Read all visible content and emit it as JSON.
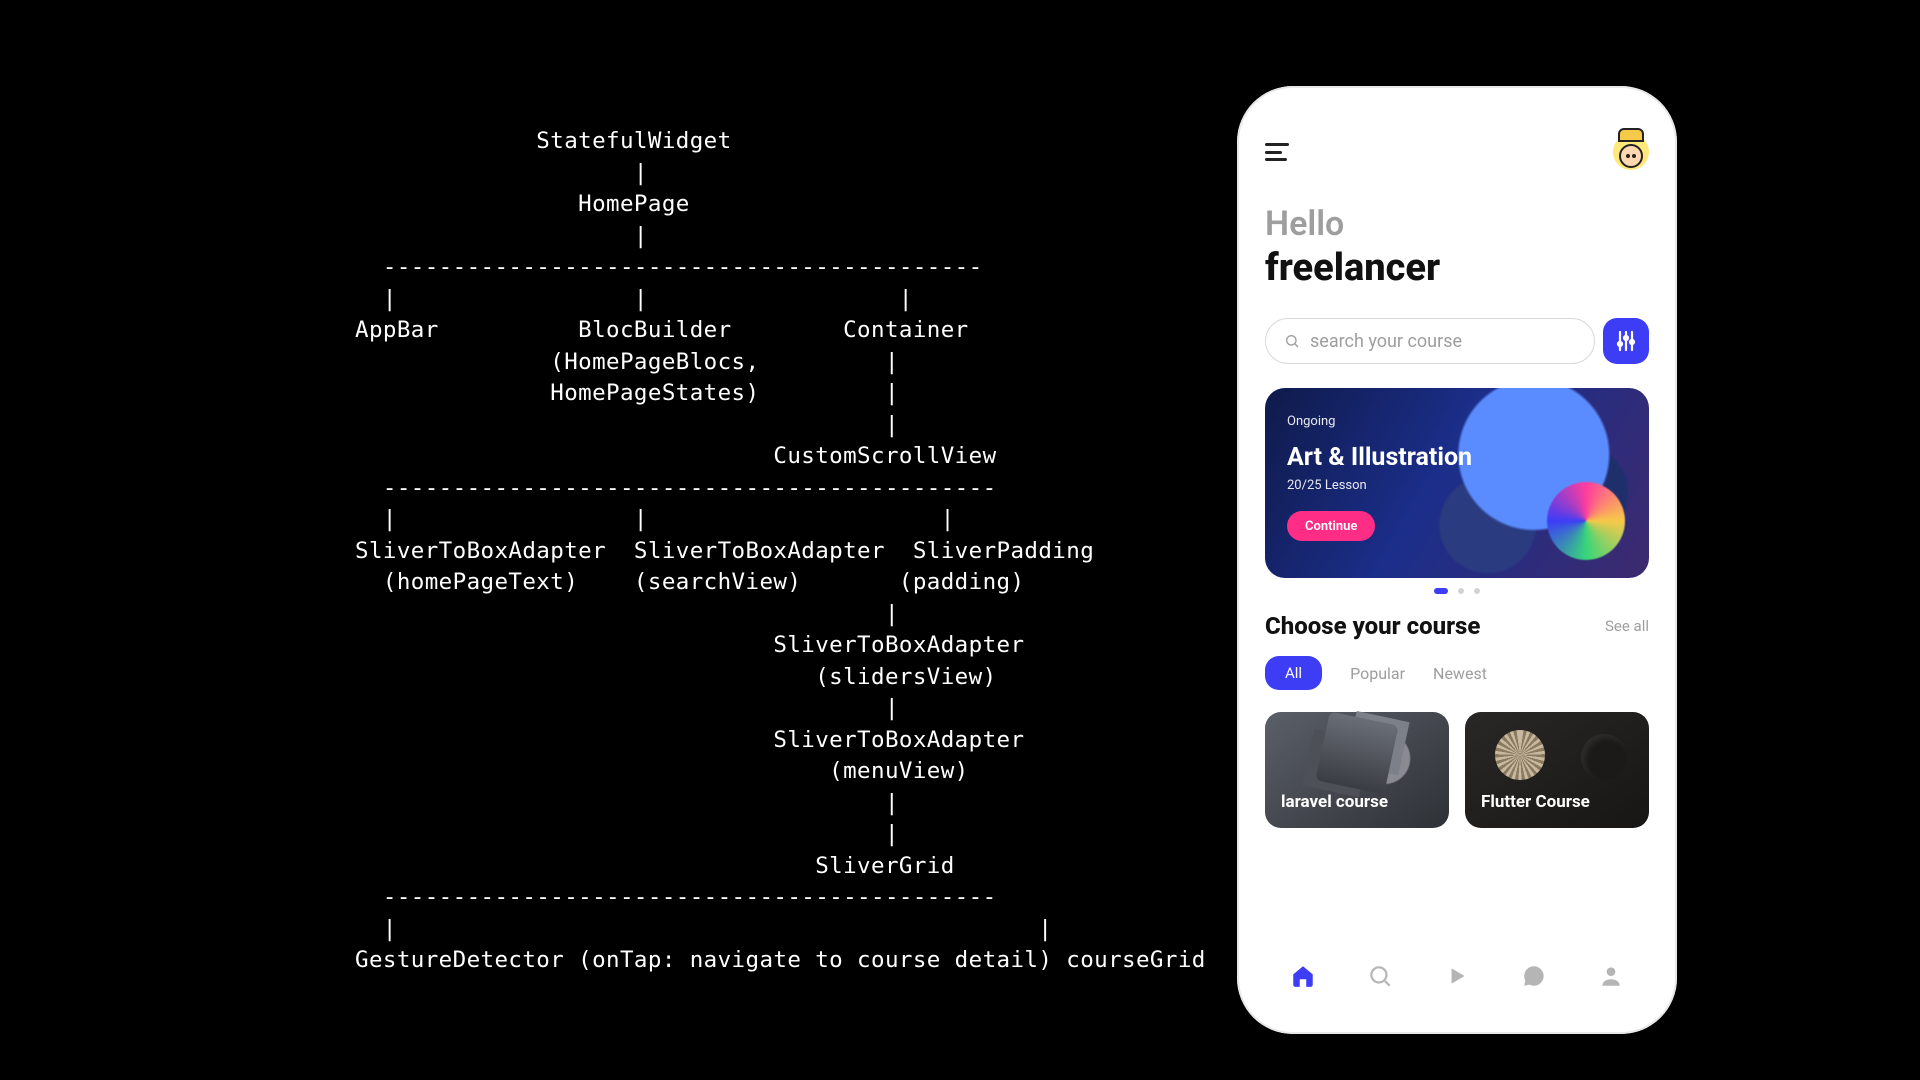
{
  "tree": {
    "lines": [
      "             StatefulWidget",
      "                    |",
      "                HomePage",
      "                    |",
      "  -------------------------------------------",
      "  |                 |                  |",
      "AppBar          BlocBuilder        Container",
      "              (HomePageBlocs,         |",
      "              HomePageStates)         |",
      "                                      |",
      "                              CustomScrollView",
      "  --------------------------------------------",
      "  |                 |                     |",
      "SliverToBoxAdapter  SliverToBoxAdapter  SliverPadding",
      "  (homePageText)    (searchView)       (padding)",
      "                                      |",
      "                              SliverToBoxAdapter",
      "                                 (slidersView)",
      "                                      |",
      "                              SliverToBoxAdapter",
      "                                  (menuView)",
      "                                      |",
      "                                      |",
      "                                 SliverGrid",
      "  --------------------------------------------",
      "  |                                              |",
      "GestureDetector (onTap: navigate to course detail) courseGrid"
    ]
  },
  "phone": {
    "greeting": {
      "hello": "Hello",
      "name": "freelancer"
    },
    "search": {
      "placeholder": "search your course"
    },
    "banner": {
      "label": "Ongoing",
      "title": "Art & Illustration",
      "progress": "20/25 Lesson",
      "action": "Continue"
    },
    "section": {
      "title": "Choose your course",
      "see_all": "See all"
    },
    "tabs": {
      "items": [
        "All",
        "Popular",
        "Newest"
      ],
      "active_index": 0
    },
    "cards": [
      {
        "title": "laravel course"
      },
      {
        "title": "Flutter Course"
      }
    ],
    "nav": {
      "active_index": 0
    }
  }
}
